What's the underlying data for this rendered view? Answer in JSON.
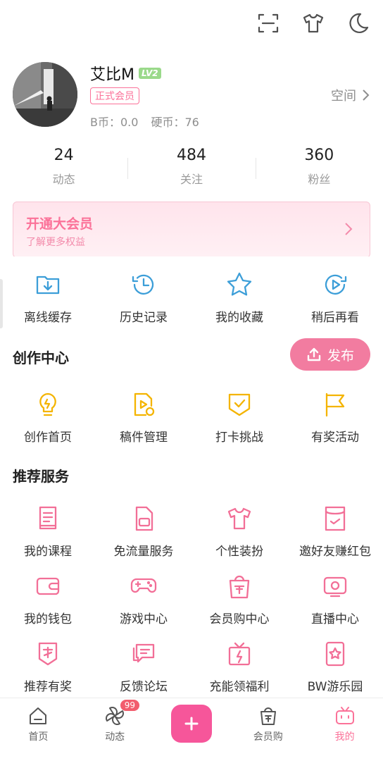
{
  "topbar": {
    "icons": [
      "scan-icon",
      "outfit-icon",
      "night-mode-icon"
    ]
  },
  "profile": {
    "username": "艾比M",
    "level": "LV2",
    "member_tag": "正式会员",
    "bcoin": "B币：0.0",
    "coin": "硬币：76",
    "space_link": "空间"
  },
  "stats": [
    {
      "value": "24",
      "label": "动态"
    },
    {
      "value": "484",
      "label": "关注"
    },
    {
      "value": "360",
      "label": "粉丝"
    }
  ],
  "vip": {
    "title": "开通大会员",
    "subtitle": "了解更多权益"
  },
  "quick": [
    {
      "label": "离线缓存",
      "icon": "offline-cache-icon"
    },
    {
      "label": "历史记录",
      "icon": "history-icon"
    },
    {
      "label": "我的收藏",
      "icon": "favorite-star-icon"
    },
    {
      "label": "稍后再看",
      "icon": "watch-later-icon"
    }
  ],
  "creation": {
    "title": "创作中心",
    "publish_label": "发布",
    "items": [
      {
        "label": "创作首页",
        "icon": "lightbulb-icon"
      },
      {
        "label": "稿件管理",
        "icon": "manuscript-icon"
      },
      {
        "label": "打卡挑战",
        "icon": "checkin-icon"
      },
      {
        "label": "有奖活动",
        "icon": "flag-icon"
      }
    ]
  },
  "services": {
    "title": "推荐服务",
    "row1": [
      {
        "label": "我的课程",
        "icon": "course-icon"
      },
      {
        "label": "免流量服务",
        "icon": "sim-card-icon"
      },
      {
        "label": "个性装扮",
        "icon": "tshirt-icon"
      },
      {
        "label": "邀好友赚红包",
        "icon": "red-packet-icon"
      }
    ],
    "row2": [
      {
        "label": "我的钱包",
        "icon": "wallet-icon"
      },
      {
        "label": "游戏中心",
        "icon": "gamepad-icon"
      },
      {
        "label": "会员购中心",
        "icon": "shopping-bag-icon"
      },
      {
        "label": "直播中心",
        "icon": "tv-icon"
      }
    ],
    "row3": [
      {
        "label": "推荐有奖",
        "icon": "reward-icon"
      },
      {
        "label": "反馈论坛",
        "icon": "chat-icon"
      },
      {
        "label": "充能领福利",
        "icon": "gift-box-icon"
      },
      {
        "label": "BW游乐园",
        "icon": "ticket-icon"
      }
    ]
  },
  "bottom_nav": [
    {
      "label": "首页",
      "icon": "home-icon"
    },
    {
      "label": "动态",
      "icon": "pinwheel-icon",
      "badge": "99"
    },
    {
      "label": "",
      "icon": "plus-icon"
    },
    {
      "label": "会员购",
      "icon": "shopping-bag-icon"
    },
    {
      "label": "我的",
      "icon": "tv-icon"
    }
  ],
  "colors": {
    "accent": "#fb7299",
    "blue_icon": "#3c9ed8",
    "yellow_icon": "#f4b400",
    "pink_icon": "#f26f97"
  }
}
